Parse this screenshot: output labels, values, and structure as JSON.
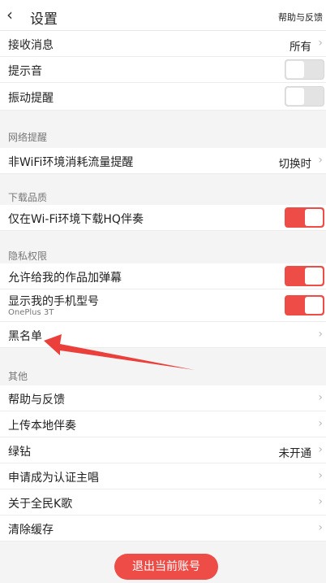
{
  "header": {
    "back_icon": "chevron-left-icon",
    "title": "设置",
    "help_label": "帮助与反馈"
  },
  "rows": {
    "receive_messages": {
      "label": "接收消息",
      "value": "所有"
    },
    "sound": {
      "label": "提示音",
      "toggle_on": false
    },
    "vibration": {
      "label": "振动提醒",
      "toggle_on": false
    }
  },
  "sections": {
    "network": {
      "title": "网络提醒"
    },
    "download": {
      "title": "下载品质"
    },
    "privacy": {
      "title": "隐私权限"
    },
    "other": {
      "title": "其他"
    }
  },
  "network": {
    "non_wifi": {
      "label": "非WiFi环境消耗流量提醒",
      "value": "切换时"
    }
  },
  "download": {
    "wifi_hq": {
      "label": "仅在Wi-Fi环境下载HQ伴奏",
      "toggle_on": true
    }
  },
  "privacy": {
    "danmaku": {
      "label": "允许给我的作品加弹幕",
      "toggle_on": true
    },
    "phone_model": {
      "label": "显示我的手机型号",
      "sub": "OnePlus 3T",
      "toggle_on": true
    },
    "blacklist": {
      "label": "黑名单"
    }
  },
  "other": {
    "help": {
      "label": "帮助与反馈"
    },
    "upload": {
      "label": "上传本地伴奏"
    },
    "green_diamond": {
      "label": "绿钻",
      "value": "未开通"
    },
    "certify": {
      "label": "申请成为认证主唱"
    },
    "about": {
      "label": "关于全民K歌"
    },
    "clear_cache": {
      "label": "清除缓存"
    }
  },
  "logout": {
    "label": "退出当前账号"
  },
  "colors": {
    "accent": "#ee4d47",
    "annotation_arrow": "#ea3f3a"
  }
}
